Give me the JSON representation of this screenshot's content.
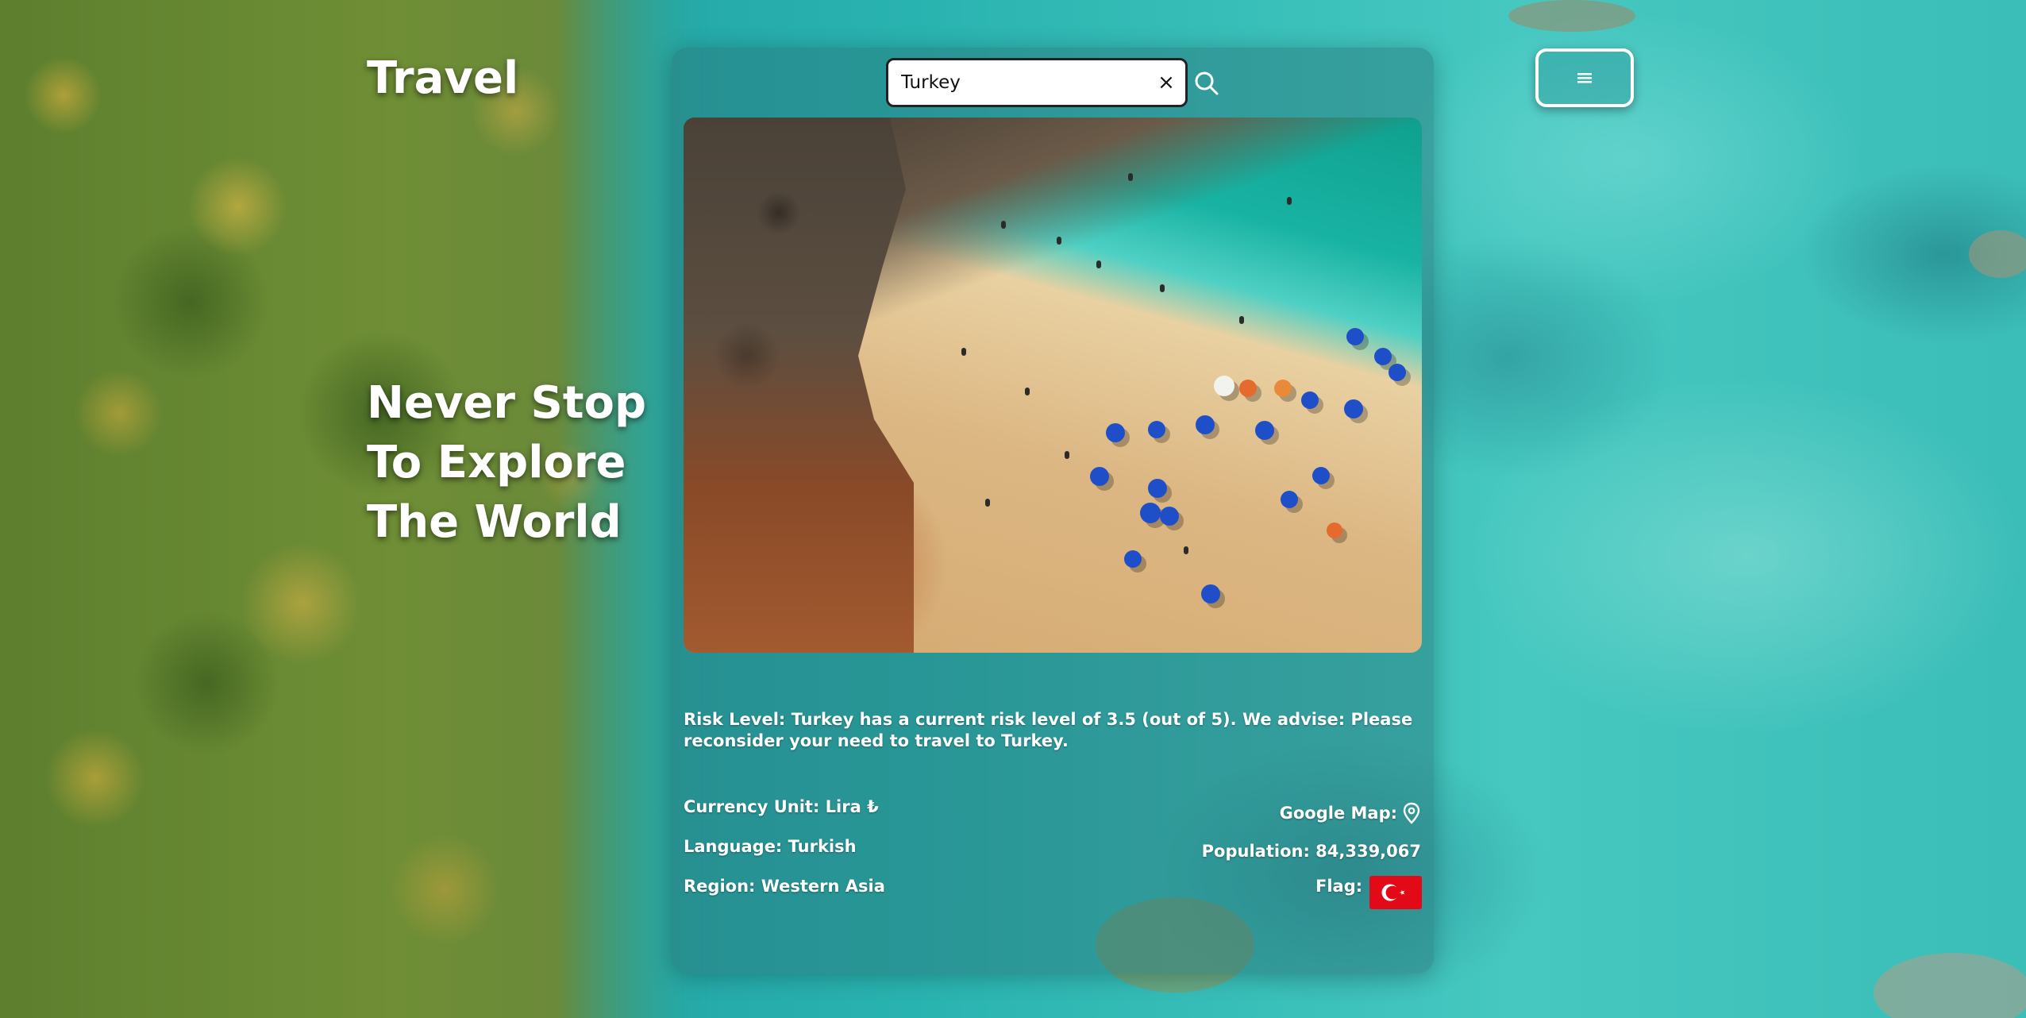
{
  "brand": {
    "title": "Travel"
  },
  "hero": {
    "lines": [
      "Never Stop",
      "To Explore",
      "The World"
    ]
  },
  "search": {
    "value": "Turkey",
    "clear_label": "×"
  },
  "menu": {
    "icon": "hamburger-icon"
  },
  "country": {
    "risk_text": "Risk Level: Turkey has a current risk level of 3.5 (out of 5). We advise: Please reconsider your need to travel to Turkey.",
    "currency": "Currency Unit: Lira ₺",
    "language": "Language: Turkish",
    "region": "Region: Western Asia",
    "map_label": "Google Map:",
    "population": "Population: 84,339,067",
    "flag_label": "Flag:",
    "flag_colors": {
      "red": "#e30a17",
      "white": "#ffffff"
    }
  },
  "icons": {
    "search": "search-icon",
    "map": "map-pin-icon",
    "flag": "turkey-flag-icon"
  }
}
